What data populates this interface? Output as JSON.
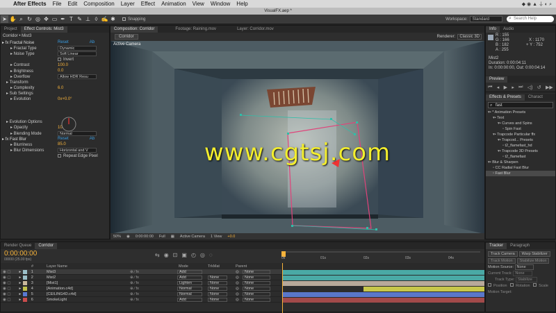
{
  "menubar": {
    "apple": "",
    "app": "After Effects",
    "items": [
      "File",
      "Edit",
      "Composition",
      "Layer",
      "Effect",
      "Animation",
      "View",
      "Window",
      "Help"
    ]
  },
  "titlebar": {
    "title": "VisualFX.aep *"
  },
  "toolbar": {
    "snapping": "Snapping",
    "workspace_label": "Workspace:",
    "workspace_value": "Standard",
    "search_placeholder": "Search Help"
  },
  "fx": {
    "tabs": [
      "Project",
      "Effect Controls: Mist3"
    ],
    "header": "Corridor • Mist3",
    "rows": [
      {
        "label": "fx Fractal Noise",
        "value": "Reset",
        "value2": "Ab",
        "indent": 0,
        "type": "text"
      },
      {
        "label": "Fractal Type",
        "value": "Dynamic",
        "indent": 2,
        "type": "select"
      },
      {
        "label": "Noise Type",
        "value": "Soft Linear",
        "indent": 2,
        "type": "select"
      },
      {
        "label": "",
        "value": "Invert",
        "indent": 2,
        "type": "check"
      },
      {
        "label": "Contrast",
        "value": "100.0",
        "indent": 2,
        "type": "num"
      },
      {
        "label": "Brightness",
        "value": "0.0",
        "indent": 2,
        "type": "num"
      },
      {
        "label": "Overflow",
        "value": "Allow HDR Resu",
        "indent": 2,
        "type": "select"
      },
      {
        "label": "Transform",
        "value": "",
        "indent": 1,
        "type": "text"
      },
      {
        "label": "Complexity",
        "value": "6.0",
        "indent": 2,
        "type": "num"
      },
      {
        "label": "Sub Settings",
        "value": "",
        "indent": 1,
        "type": "text"
      },
      {
        "label": "Evolution",
        "value": "0x+0.0°",
        "indent": 2,
        "type": "num"
      },
      {
        "label": "",
        "value": "",
        "indent": 0,
        "type": "dial"
      },
      {
        "label": "",
        "value": "",
        "indent": 0,
        "type": "dial"
      },
      {
        "label": "",
        "value": "",
        "indent": 0,
        "type": "dial"
      },
      {
        "label": "Evolution Options",
        "value": "",
        "indent": 1,
        "type": "text"
      },
      {
        "label": "Opacity",
        "value": "100.0%",
        "indent": 2,
        "type": "num"
      },
      {
        "label": "Blending Mode",
        "value": "Normal",
        "indent": 2,
        "type": "select"
      },
      {
        "label": "fx Fast Blur",
        "value": "Reset",
        "value2": "Ab",
        "indent": 0,
        "type": "text"
      },
      {
        "label": "Blurriness",
        "value": "85.0",
        "indent": 2,
        "type": "num"
      },
      {
        "label": "Blur Dimensions",
        "value": "Horizontal and V",
        "indent": 2,
        "type": "select"
      },
      {
        "label": "",
        "value": "Repeat Edge Pixel",
        "indent": 2,
        "type": "check"
      }
    ]
  },
  "comp": {
    "tabs": [
      "Composition: Corridor",
      "Footage: Raining.mov",
      "Layer: Corridor.mov"
    ],
    "subtab": "Corridor",
    "renderer": "Renderer:",
    "renderer_value": "Classic 3D",
    "view_label": "Active Camera",
    "footer": [
      "50%",
      "0:00:00:00",
      "Full",
      "Active Camera",
      "1 View",
      "+0.0"
    ]
  },
  "info": {
    "tabs": [
      "Info",
      "Audio"
    ],
    "R": "R : 155",
    "G": "G : 166",
    "B": "B : 182",
    "A": "A : 255",
    "X": "X : 1170",
    "Y": "+ Y : 752",
    "layer": "Mist2",
    "duration": "Duration: 0:00:04:11",
    "inout": "In: 0:00:00:00, Out: 0:00:04:14"
  },
  "preview": {
    "tab": "Preview"
  },
  "effects": {
    "tabs": [
      "Effects & Presets",
      "Charact"
    ],
    "search": "fast",
    "tree": [
      {
        "label": "* Animation Presets",
        "level": 0
      },
      {
        "label": "Text",
        "level": 1
      },
      {
        "label": "Curves and Spins",
        "level": 2
      },
      {
        "label": "Spin Fast",
        "level": 3
      },
      {
        "label": "Trapcode Particular ffx",
        "level": 1
      },
      {
        "label": "Trapcod... Presets",
        "level": 2
      },
      {
        "label": "t2_flamefast_hd",
        "level": 3
      },
      {
        "label": "Trapcode 3D Presets",
        "level": 2
      },
      {
        "label": "t2_flamefast",
        "level": 3
      },
      {
        "label": "Blur & Sharpen",
        "level": 0
      },
      {
        "label": "CC Radial Fast Blur",
        "level": 1
      },
      {
        "label": "Fast Blur",
        "level": 1
      }
    ]
  },
  "timeline": {
    "tabs": [
      "Render Queue",
      "Corridor"
    ],
    "timecode": "0:00:00:00",
    "fps": "00000 (25.00 fps)",
    "col_headers": [
      "#",
      "Layer Name",
      "Mode",
      "TrkMat",
      "Parent"
    ],
    "ruler": [
      "0s",
      "01s",
      "02s",
      "03s",
      "04s"
    ],
    "layers": [
      {
        "num": "1",
        "name": "Mist3",
        "color": "#9cc0c9",
        "mode": "Add",
        "trk": "",
        "parent": "None",
        "bar": "#4aa9a5",
        "barstart": 0,
        "barend": 1
      },
      {
        "num": "2",
        "name": "Mist2",
        "color": "#9cc0c9",
        "mode": "Add",
        "trk": "None",
        "parent": "None",
        "bar": "#4aa9a5",
        "barstart": 0,
        "barend": 1
      },
      {
        "num": "3",
        "name": "[Mist1]",
        "color": "#c9b89c",
        "mode": "Lighten",
        "trk": "None",
        "parent": "None",
        "bar": "#b8a99a",
        "barstart": 0,
        "barend": 1
      },
      {
        "num": "4",
        "name": "[Animation.c4d]",
        "color": "#c2c24c",
        "mode": "Normal",
        "trk": "None",
        "parent": "None",
        "bar": "#c7c74a",
        "barstart": 0.4,
        "barend": 1
      },
      {
        "num": "5",
        "name": "[CEILING4D.c4d]",
        "color": "#5a7ad2",
        "mode": "Normal",
        "trk": "None",
        "parent": "None",
        "bar": "#5a77c9",
        "barstart": 0,
        "barend": 1
      },
      {
        "num": "6",
        "name": "SmokeLight",
        "color": "#c94c4c",
        "mode": "Add",
        "trk": "None",
        "parent": "None",
        "bar": "#a24a4a",
        "barstart": 0,
        "barend": 1
      }
    ]
  },
  "tracker": {
    "tabs": [
      "Tracker",
      "Paragraph"
    ],
    "buttons1": [
      "Track Camera",
      "Warp Stabilizer"
    ],
    "buttons2": [
      "Track Motion",
      "Stabilize Motion"
    ],
    "motion_source": "Motion Source:",
    "motion_source_value": "None",
    "current_track": "Current Track:",
    "current_track_value": "None",
    "track_type": "Track Type:",
    "track_type_value": "Stabilize",
    "opts": [
      "Position",
      "Rotation",
      "Scale"
    ],
    "motion_target": "Motion Target:"
  },
  "watermark": "www.cgtsj.com"
}
